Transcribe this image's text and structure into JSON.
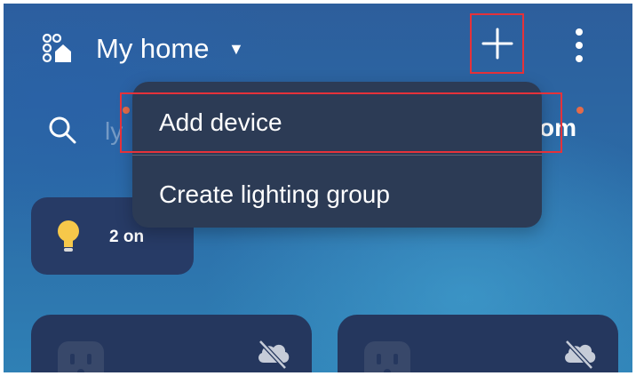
{
  "header": {
    "home_name": "My home",
    "caret_glyph": "▼",
    "home_icon": "home-devices-icon",
    "add_icon": "plus-icon",
    "more_icon": "more-vertical-icon"
  },
  "search": {
    "icon": "search-icon",
    "ghost_text": "ly",
    "tab_partial": "om"
  },
  "status_chip": {
    "icon": "lightbulb-icon",
    "label": "2 on"
  },
  "devices": [
    {
      "icon": "power-outlet-icon",
      "status_icon": "cloud-offline-icon"
    },
    {
      "icon": "power-outlet-icon",
      "status_icon": "cloud-offline-icon"
    }
  ],
  "add_menu": {
    "items": [
      {
        "label": "Add device"
      },
      {
        "label": "Create lighting group"
      }
    ]
  },
  "colors": {
    "highlight": "#e5323a",
    "menu_bg": "#2c3b55",
    "card_bg": "#25375e",
    "notification_dot": "#e46b4a",
    "bulb": "#f6c84a"
  }
}
